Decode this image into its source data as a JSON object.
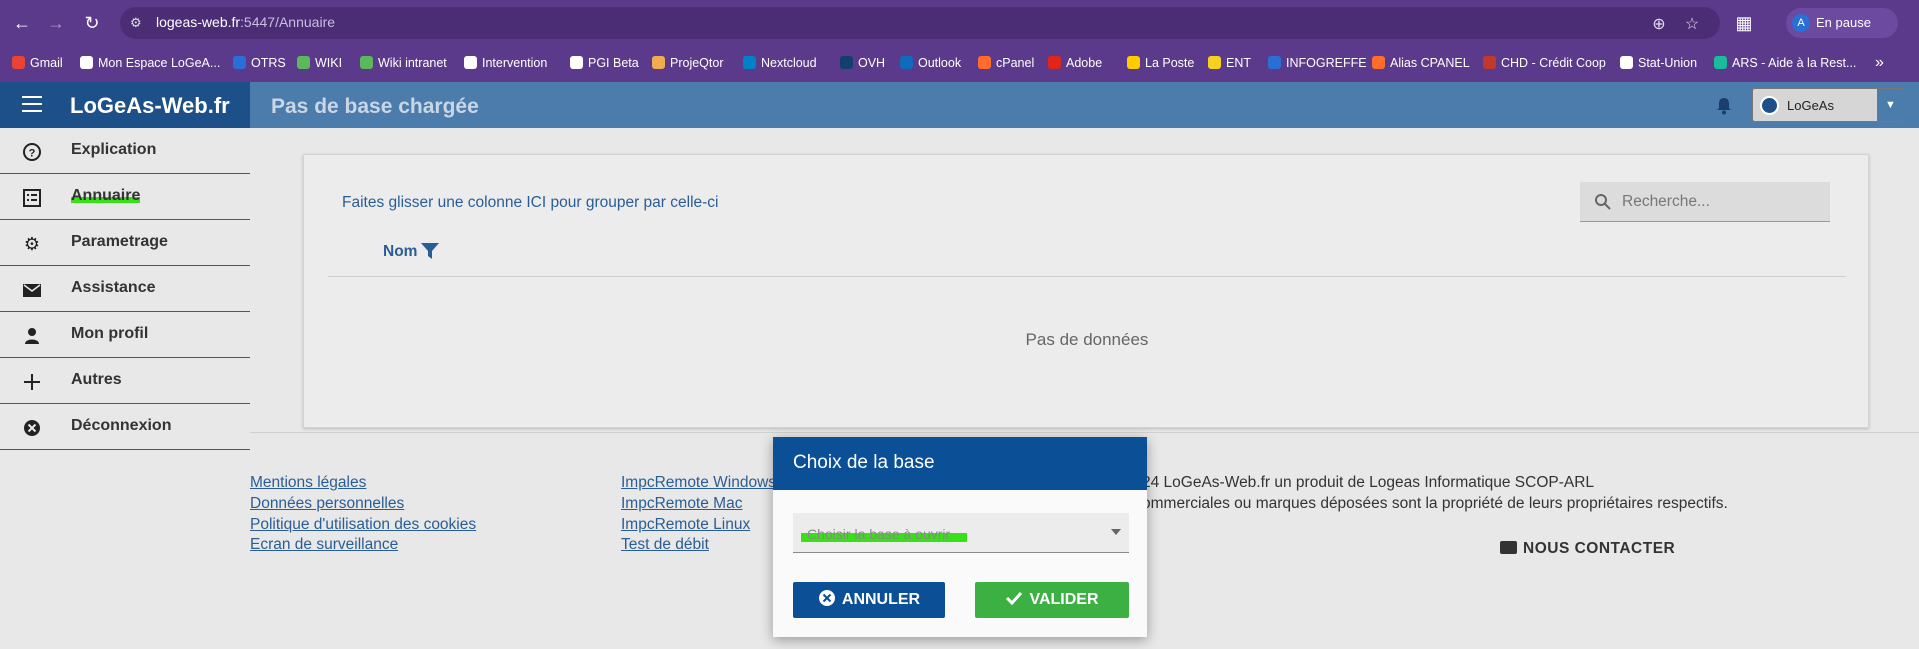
{
  "browser": {
    "url_host": "logeas-web.fr",
    "url_path": ":5447/Annuaire",
    "profile_initial": "A",
    "profile_status": "En pause",
    "bookmarks": [
      {
        "label": "Gmail",
        "color": "#ea4335"
      },
      {
        "label": "Mon Espace LoGeA...",
        "color": "#ffffff"
      },
      {
        "label": "OTRS",
        "color": "#2a6fd6"
      },
      {
        "label": "WIKI",
        "color": "#5cb85c"
      },
      {
        "label": "Wiki intranet",
        "color": "#5cb85c"
      },
      {
        "label": "Intervention",
        "color": "#ffffff"
      },
      {
        "label": "PGI Beta",
        "color": "#ffffff"
      },
      {
        "label": "ProjeQtor",
        "color": "#f0ad4e"
      },
      {
        "label": "Nextcloud",
        "color": "#0082c9"
      },
      {
        "label": "OVH",
        "color": "#123f6d"
      },
      {
        "label": "Outlook",
        "color": "#0f6cbd"
      },
      {
        "label": "cPanel",
        "color": "#ff6c2c"
      },
      {
        "label": "Adobe",
        "color": "#e1251b"
      },
      {
        "label": "La Poste",
        "color": "#ffcc00"
      },
      {
        "label": "ENT",
        "color": "#f6d21e"
      },
      {
        "label": "INFOGREFFE",
        "color": "#2a6fd6"
      },
      {
        "label": "Alias CPANEL",
        "color": "#ff6c2c"
      },
      {
        "label": "CHD - Crédit Coop",
        "color": "#c0392b"
      },
      {
        "label": "Stat-Union",
        "color": "#ffffff"
      },
      {
        "label": "ARS - Aide à la Rest...",
        "color": "#1abc9c"
      }
    ]
  },
  "header": {
    "brand": "LoGeAs-Web.fr",
    "page_title": "Pas de base chargée",
    "user_name": "LoGeAs"
  },
  "sidebar": {
    "items": [
      {
        "label": "Explication",
        "icon": "help-circle-icon"
      },
      {
        "label": "Annuaire",
        "icon": "list-icon"
      },
      {
        "label": "Parametrage",
        "icon": "gear-icon"
      },
      {
        "label": "Assistance",
        "icon": "mail-icon"
      },
      {
        "label": "Mon profil",
        "icon": "person-icon"
      },
      {
        "label": "Autres",
        "icon": "plus-icon"
      },
      {
        "label": "Déconnexion",
        "icon": "close-circle-icon"
      }
    ]
  },
  "grid": {
    "group_hint": "Faites glisser une colonne ICI pour grouper par celle-ci",
    "search_placeholder": "Recherche...",
    "column_name": "Nom",
    "empty_text": "Pas de données"
  },
  "footer": {
    "legal_links": [
      "Mentions légales",
      "Données personnelles",
      "Politique d'utilisation des cookies",
      "Ecran de surveillance"
    ],
    "remote_links": [
      "ImpcRemote Windows",
      "ImpcRemote Mac",
      "ImpcRemote Linux",
      "Test de débit"
    ],
    "copyright": "24 LoGeAs-Web.fr un produit de Logeas Informatique SCOP-ARL",
    "trademark": "ommerciales ou marques déposées sont la propriété de leurs propriétaires respectifs.",
    "contact": "NOUS CONTACTER"
  },
  "dialog": {
    "title": "Choix de la base",
    "select_placeholder": "Choisir la base à ouvrir",
    "cancel_label": "ANNULER",
    "ok_label": "VALIDER"
  },
  "colors": {
    "browser": "#5b3a8c",
    "header": "#4c7cab",
    "brand_bg": "#1d4f88",
    "dialog_head": "#0b4f96",
    "ok_button": "#3cb043",
    "highlight": "#39e01a"
  }
}
